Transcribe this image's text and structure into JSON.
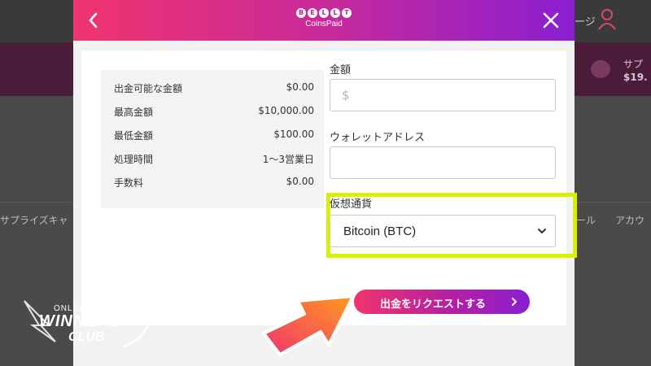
{
  "background": {
    "nav_right_text": "ージ",
    "band_right_line1": "サプ",
    "band_right_line2": "$19.",
    "tab_left": "サプライズキャ",
    "tab_right_1": "ール",
    "tab_right_2": "アカウ"
  },
  "modal": {
    "logo": {
      "letters": [
        "B",
        "E",
        "L",
        "L",
        "T"
      ],
      "provider": "CoinsPaid"
    },
    "info": [
      {
        "label": "出金可能な金額",
        "value": "$0.00"
      },
      {
        "label": "最高金額",
        "value": "$10,000.00"
      },
      {
        "label": "最低金額",
        "value": "$100.00"
      },
      {
        "label": "処理時間",
        "value": "1〜3営業日"
      },
      {
        "label": "手数料",
        "value": "$0.00"
      }
    ],
    "amount": {
      "label": "金額",
      "placeholder": "$",
      "value": ""
    },
    "wallet": {
      "label": "ウォレットアドレス",
      "value": ""
    },
    "crypto": {
      "label": "仮想通貨",
      "selected": "Bitcoin (BTC)"
    },
    "submit_label": "出金をリクエストする"
  },
  "watermark": {
    "small": "ONLINE CASINO",
    "big": "WINNERS",
    "club": "CLUB"
  },
  "colors": {
    "header_start": "#f0346e",
    "header_end": "#8a1fd0",
    "highlight": "#d9f000",
    "arrow_start": "#f0346e",
    "arrow_end": "#ff9a1f"
  }
}
